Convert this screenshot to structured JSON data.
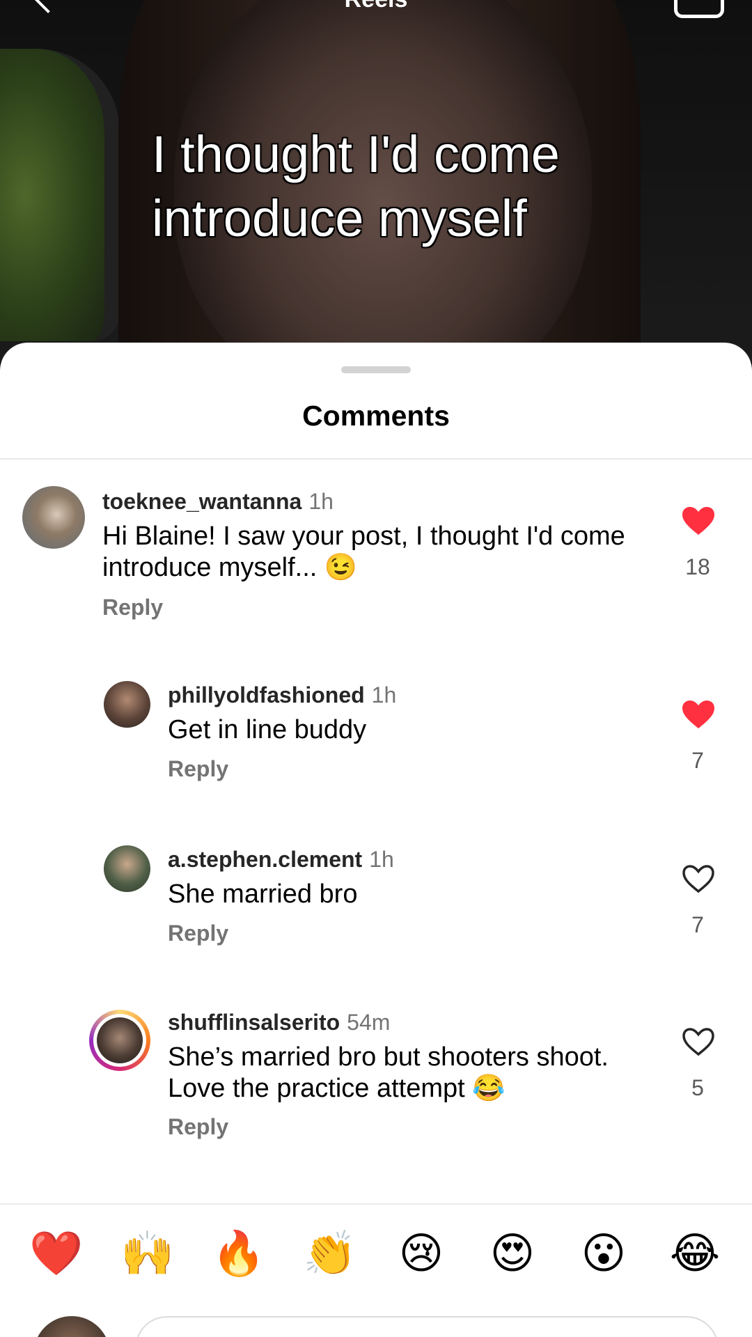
{
  "header": {
    "title": "Reels"
  },
  "video": {
    "caption": "I thought I'd come introduce myself"
  },
  "sheet": {
    "title": "Comments"
  },
  "comments": [
    {
      "username": "toeknee_wantanna",
      "time": "1h",
      "text": "Hi Blaine! I saw your post, I thought I'd come introduce myself... 😉",
      "reply_label": "Reply",
      "likes": "18",
      "liked": true
    },
    {
      "username": "phillyoldfashioned",
      "time": "1h",
      "text": "Get in line buddy",
      "reply_label": "Reply",
      "likes": "7",
      "liked": true
    },
    {
      "username": "a.stephen.clement",
      "time": "1h",
      "text": "She married bro",
      "reply_label": "Reply",
      "likes": "7",
      "liked": false
    },
    {
      "username": "shufflinsalserito",
      "time": "54m",
      "text": "She’s married bro but shooters shoot. Love the practice attempt 😂",
      "reply_label": "Reply",
      "likes": "5",
      "liked": false,
      "has_story_ring": true
    }
  ],
  "quick_reactions": [
    "❤️",
    "🙌",
    "🔥",
    "👏",
    "😢",
    "😍",
    "😮",
    "😂"
  ],
  "colors": {
    "like_red": "#ff3040",
    "secondary_text": "#737373",
    "story_ring_start": "#feda75",
    "story_ring_mid": "#d62976",
    "story_ring_end": "#962fbf"
  }
}
